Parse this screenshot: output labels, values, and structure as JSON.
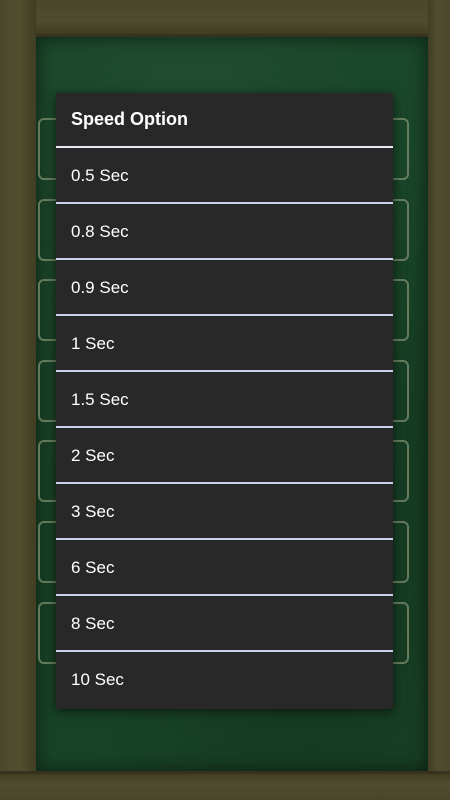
{
  "dialog": {
    "title": "Speed Option",
    "options": [
      "0.5 Sec",
      "0.8 Sec",
      "0.9 Sec",
      "1 Sec",
      "1.5 Sec",
      "2 Sec",
      "3 Sec",
      "6 Sec",
      "8 Sec",
      "10 Sec"
    ]
  },
  "colors": {
    "dialog_background": "#282828",
    "divider": "#c9d2ec",
    "chalkboard": "#1c4a2b",
    "wood": "#5c5836"
  }
}
